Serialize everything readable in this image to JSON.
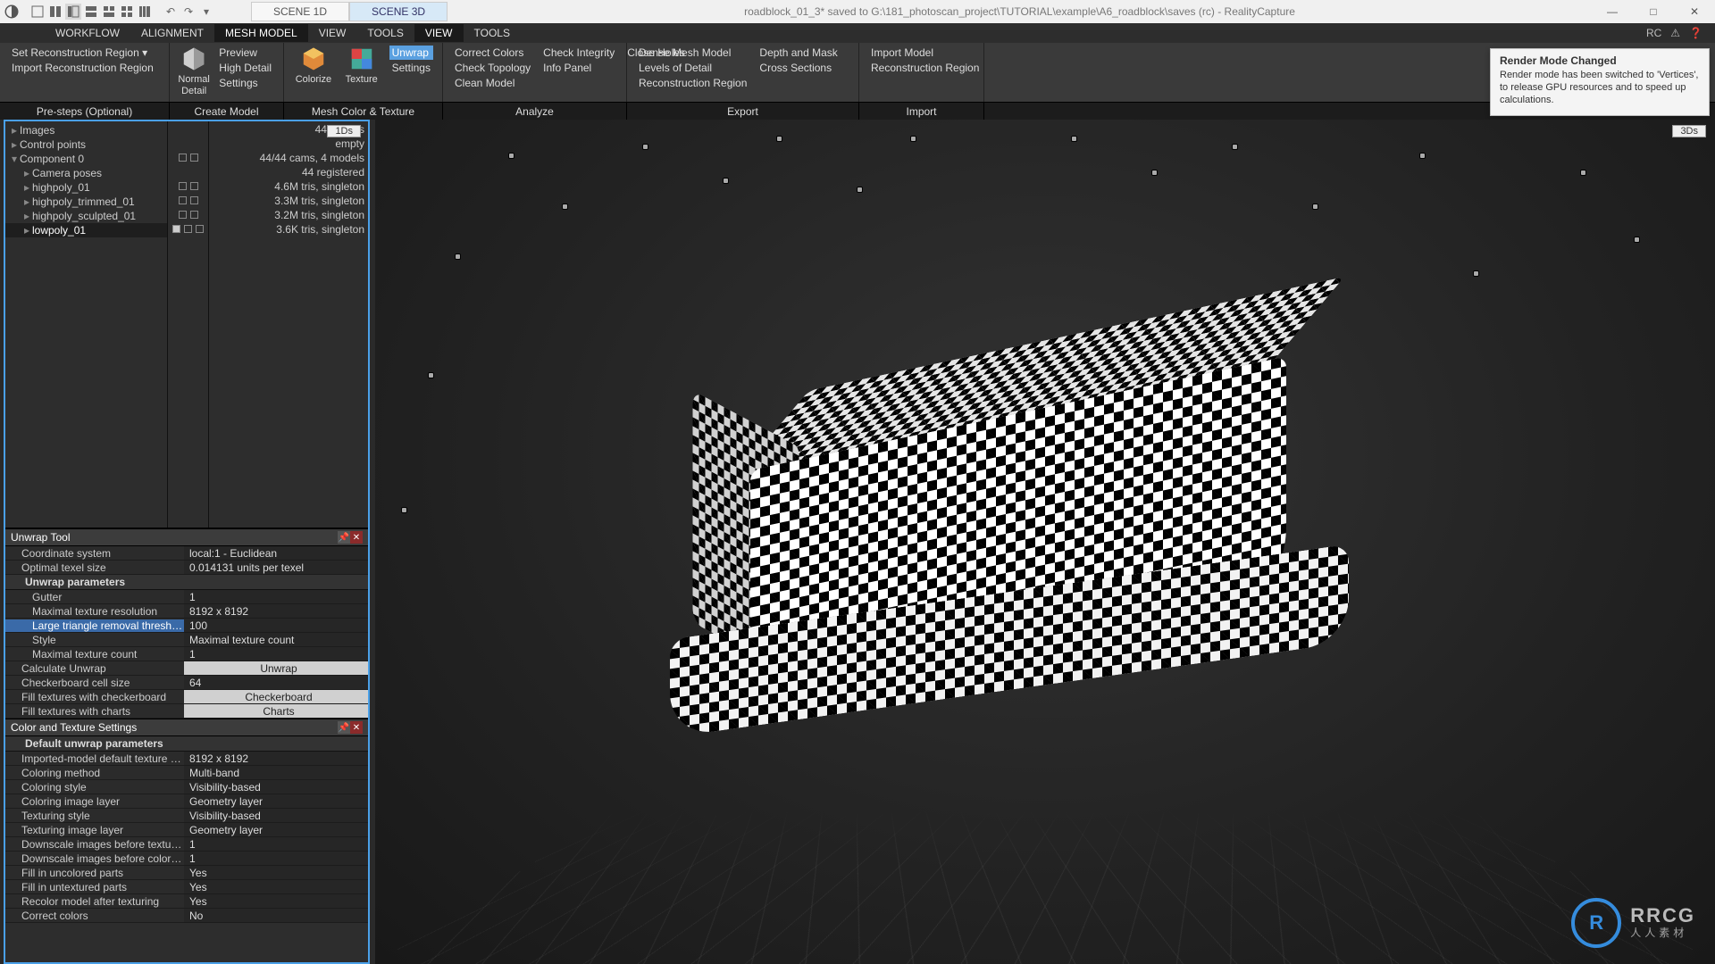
{
  "app": {
    "title": "roadblock_01_3* saved to G:\\181_photoscan_project\\TUTORIAL\\example\\A6_roadblock\\saves (rc) - RealityCapture",
    "rc_label": "RC"
  },
  "scene_tabs": {
    "one": "SCENE 1D",
    "three": "SCENE 3D"
  },
  "menus": [
    "WORKFLOW",
    "ALIGNMENT",
    "MESH MODEL",
    "VIEW",
    "TOOLS",
    "VIEW",
    "TOOLS"
  ],
  "ribbon": {
    "presteps": {
      "set_region": "Set Reconstruction Region ▾",
      "import_region": "Import Reconstruction Region"
    },
    "create": {
      "normal": "Normal Detail",
      "preview": "Preview",
      "high": "High Detail",
      "settings": "Settings"
    },
    "meshcolor": {
      "colorize": "Colorize",
      "texture": "Texture",
      "unwrap": "Unwrap",
      "settings": "Settings"
    },
    "analyze": {
      "correct_colors": "Correct Colors",
      "check_integrity": "Check Integrity",
      "close_holes": "Close Holes",
      "check_topology": "Check Topology",
      "info_panel": "Info Panel",
      "clean_model": "Clean Model"
    },
    "export": {
      "dense": "Dense Mesh Model",
      "depth_mask": "Depth and Mask",
      "lod": "Levels of Detail",
      "cross": "Cross Sections",
      "recon_region": "Reconstruction Region"
    },
    "import": {
      "model": "Import Model",
      "recon_region": "Reconstruction Region"
    },
    "labels": {
      "presteps": "Pre-steps (Optional)",
      "create": "Create Model",
      "meshcolor": "Mesh Color & Texture",
      "analyze": "Analyze",
      "export": "Export",
      "import": "Import"
    }
  },
  "outline": {
    "badge": "1Ds",
    "rows": [
      {
        "label": "Images",
        "info": "44 images"
      },
      {
        "label": "Control points",
        "info": "empty"
      },
      {
        "label": "Component 0",
        "info": "44/44 cams, 4 models"
      },
      {
        "label": "Camera poses",
        "info": "44 registered"
      },
      {
        "label": "highpoly_01",
        "info": "4.6M tris, singleton"
      },
      {
        "label": "highpoly_trimmed_01",
        "info": "3.3M tris, singleton"
      },
      {
        "label": "highpoly_sculpted_01",
        "info": "3.2M tris, singleton"
      },
      {
        "label": "lowpoly_01",
        "info": "3.6K tris, singleton"
      }
    ]
  },
  "unwrap_tool": {
    "title": "Unwrap Tool",
    "rows": [
      {
        "k": "Coordinate system",
        "v": "local:1 - Euclidean"
      },
      {
        "k": "Optimal texel size",
        "v": "0.014131 units per texel"
      }
    ],
    "params_title": "Unwrap parameters",
    "params": [
      {
        "k": "Gutter",
        "v": "1"
      },
      {
        "k": "Maximal texture resolution",
        "v": "8192 x 8192"
      },
      {
        "k": "Large triangle removal threshold",
        "v": "100",
        "hl": true
      },
      {
        "k": "Style",
        "v": "Maximal texture count"
      },
      {
        "k": "Maximal texture count",
        "v": "1"
      }
    ],
    "actions": [
      {
        "k": "Calculate Unwrap",
        "btn": "Unwrap"
      },
      {
        "k": "Checkerboard cell size",
        "v": "64"
      },
      {
        "k": "Fill textures with checkerboard",
        "btn": "Checkerboard"
      },
      {
        "k": "Fill textures with charts",
        "btn": "Charts"
      }
    ]
  },
  "color_settings": {
    "title": "Color and Texture Settings",
    "sub": "Default unwrap parameters",
    "rows": [
      {
        "k": "Imported-model default texture re…",
        "v": "8192 x 8192"
      },
      {
        "k": "Coloring method",
        "v": "Multi-band"
      },
      {
        "k": "Coloring style",
        "v": "Visibility-based"
      },
      {
        "k": "Coloring image layer",
        "v": "Geometry layer"
      },
      {
        "k": "Texturing style",
        "v": "Visibility-based"
      },
      {
        "k": "Texturing image layer",
        "v": "Geometry layer"
      },
      {
        "k": "Downscale images before texturing",
        "v": "1"
      },
      {
        "k": "Downscale images before coloring",
        "v": "1"
      },
      {
        "k": "Fill in uncolored parts",
        "v": "Yes"
      },
      {
        "k": "Fill in untextured parts",
        "v": "Yes"
      },
      {
        "k": "Recolor model after texturing",
        "v": "Yes"
      },
      {
        "k": "Correct colors",
        "v": "No"
      }
    ]
  },
  "viewport": {
    "badge": "3Ds"
  },
  "toast": {
    "title": "Render Mode Changed",
    "body": "Render mode has been switched to 'Vertices', to release GPU resources and to speed up calculations."
  },
  "watermark": {
    "main": "RRCG",
    "sub": "人人素材"
  }
}
